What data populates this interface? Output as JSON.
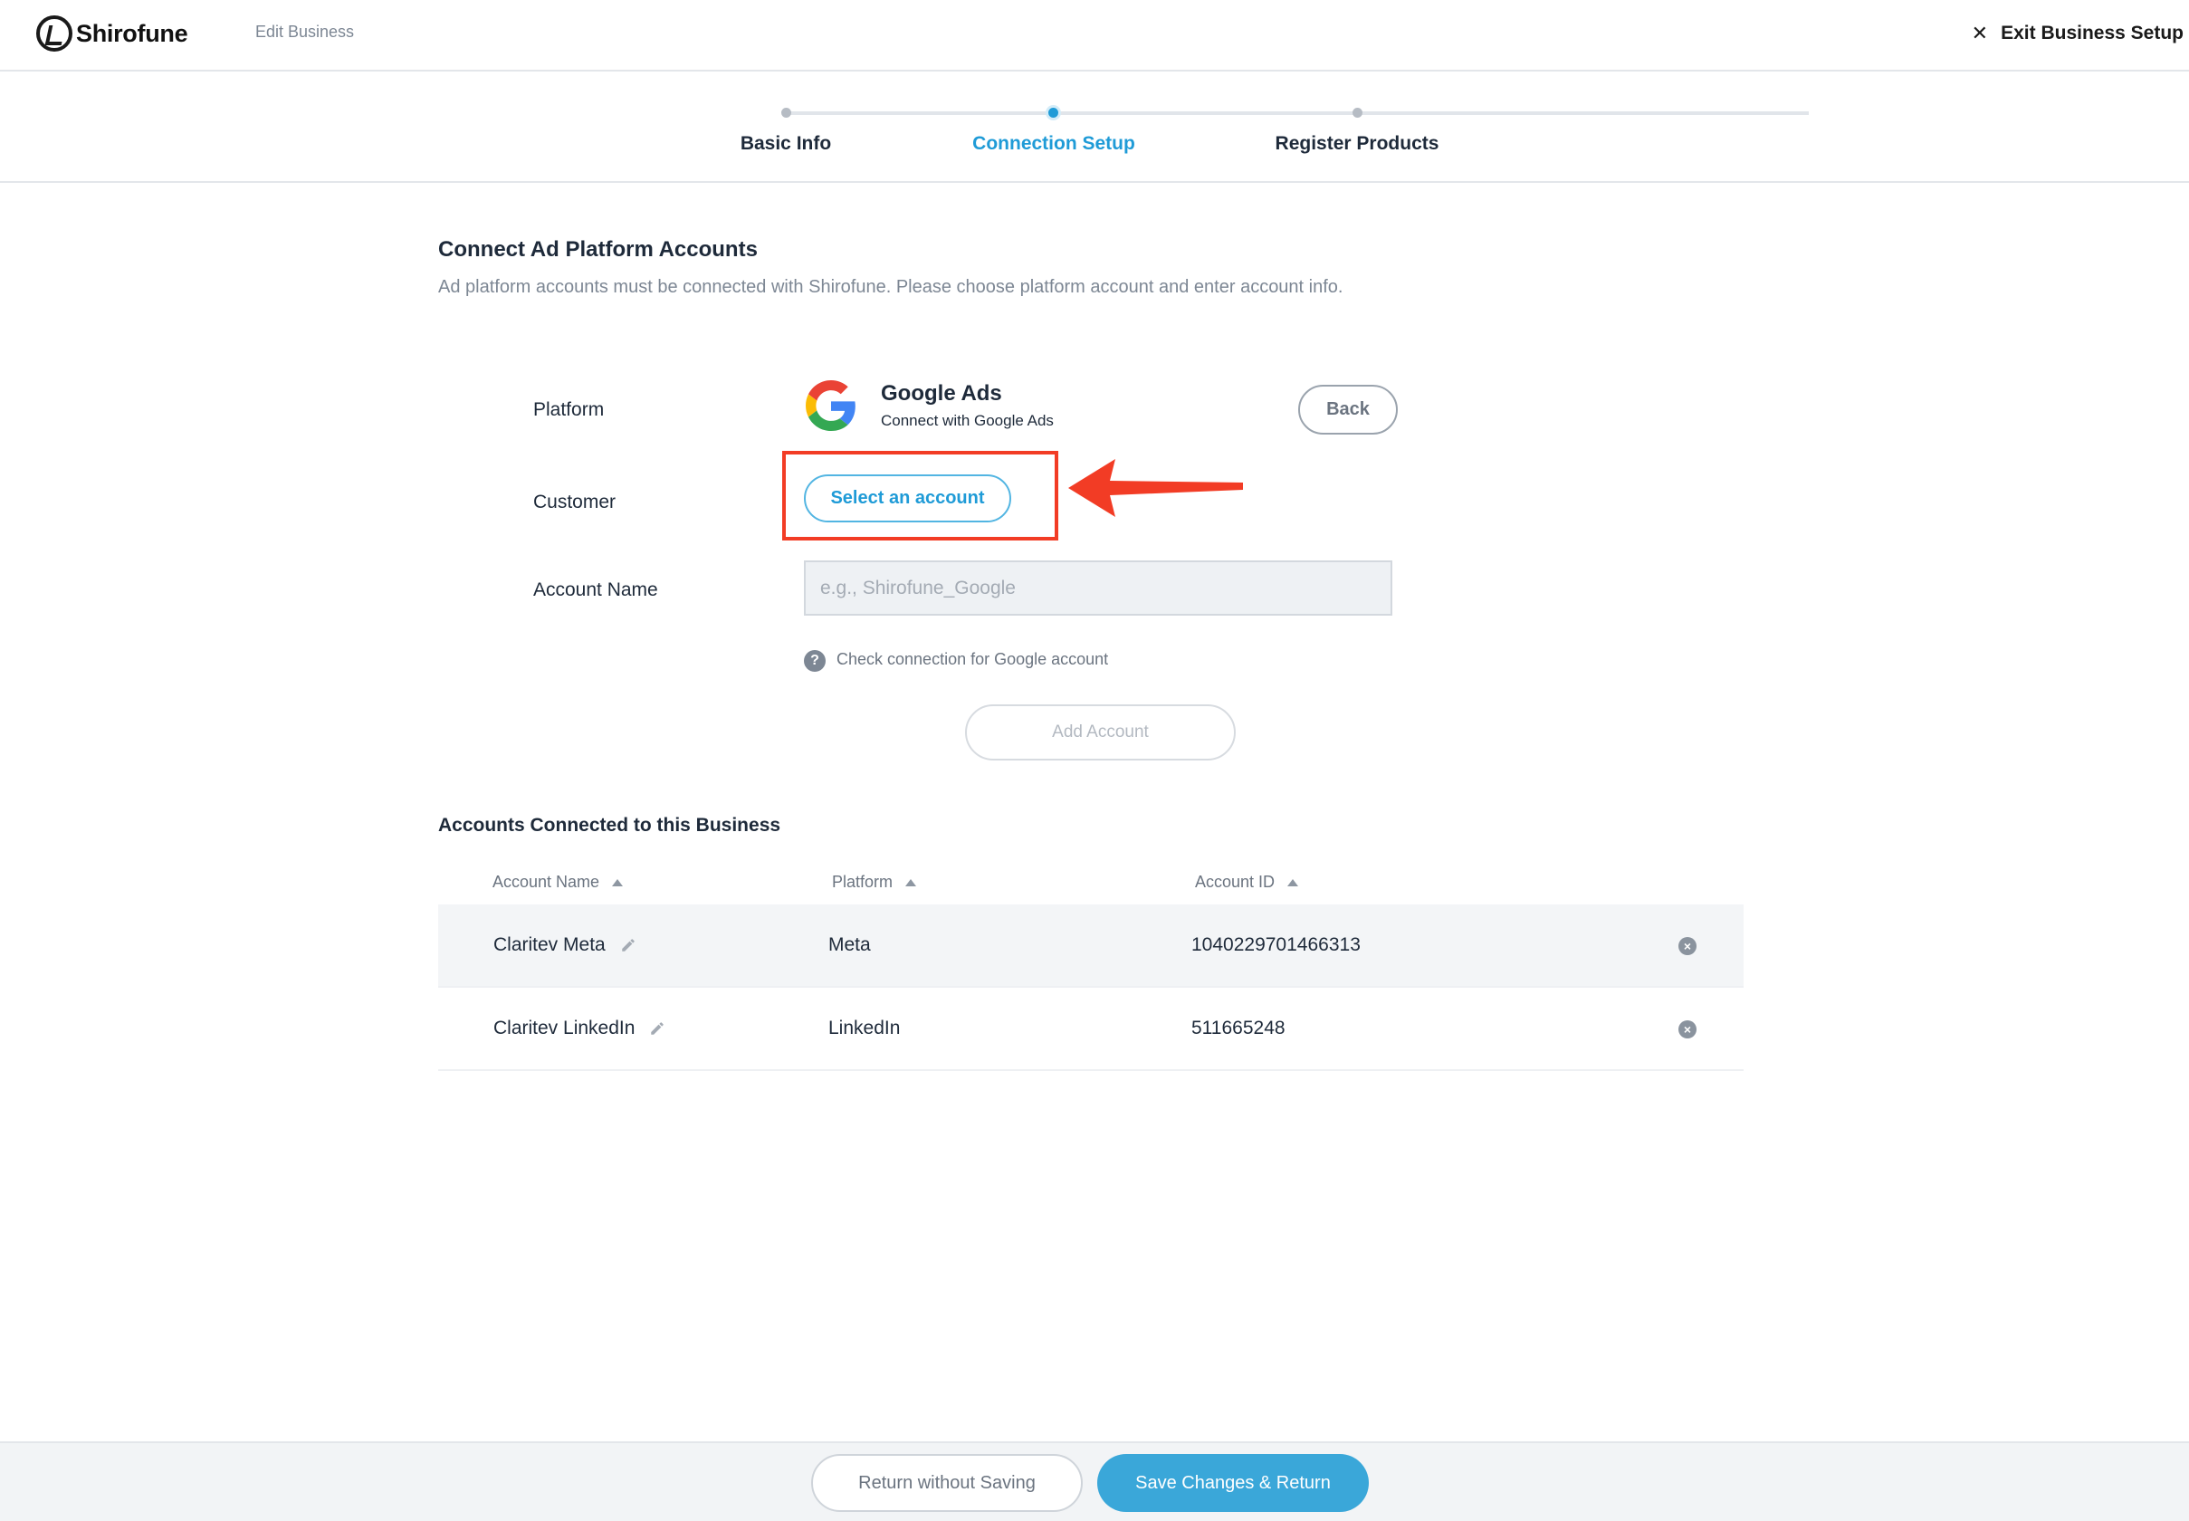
{
  "header": {
    "brand": "Shirofune",
    "breadcrumb": "Edit Business",
    "exit_label": "Exit Business Setup"
  },
  "stepper": {
    "steps": [
      {
        "label": "Basic Info",
        "state": "done"
      },
      {
        "label": "Connection Setup",
        "state": "active"
      },
      {
        "label": "Register Products",
        "state": "pending"
      }
    ]
  },
  "section": {
    "title": "Connect Ad Platform Accounts",
    "description": "Ad platform accounts must be connected with Shirofune. Please choose platform account and enter account info."
  },
  "form": {
    "platform_label": "Platform",
    "platform_name": "Google Ads",
    "platform_sub": "Connect with Google Ads",
    "back_label": "Back",
    "customer_label": "Customer",
    "select_account_label": "Select an account",
    "account_name_label": "Account Name",
    "account_name_value": "",
    "account_name_placeholder": "e.g., Shirofune_Google",
    "help_icon": "?",
    "help_text": "Check connection for Google account",
    "add_account_label": "Add Account"
  },
  "accounts": {
    "title": "Accounts Connected to this Business",
    "columns": [
      "Account Name",
      "Platform",
      "Account ID"
    ],
    "rows": [
      {
        "name": "Claritev Meta",
        "platform": "Meta",
        "account_id": "1040229701466313"
      },
      {
        "name": "Claritev LinkedIn",
        "platform": "LinkedIn",
        "account_id": "511665248"
      }
    ]
  },
  "footer": {
    "return_label": "Return without Saving",
    "save_label": "Save Changes & Return"
  },
  "colors": {
    "accent": "#1f9bd7",
    "save_button": "#3aa7d9",
    "highlight": "#f23c25"
  }
}
